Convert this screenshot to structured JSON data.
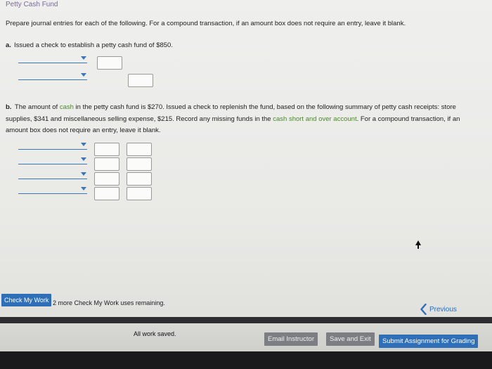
{
  "header": {
    "title": "Petty Cash Fund"
  },
  "instructions": "Prepare journal entries for each of the following. For a compound transaction, if an amount box does not require an entry, leave it blank.",
  "part_a": {
    "letter": "a.",
    "text": "Issued a check to establish a petty cash fund of $850."
  },
  "part_b": {
    "letter": "b.",
    "text_1": "The amount of ",
    "cash_link": "cash",
    "text_2": " in the petty cash fund is $270. Issued a check to replenish the fund, based on the following summary of petty cash receipts: store supplies, $341 and miscellaneous selling expense, $215. Record any missing funds in the ",
    "cash_short_link": "cash short and over account",
    "text_3": ". For a compound transaction, if an amount box does not require an entry, leave it blank."
  },
  "footer": {
    "check_my_work": "Check My Work",
    "remaining": "2 more Check My Work uses remaining.",
    "previous": "Previous",
    "saved_status": "All work saved.",
    "email_instructor": "Email Instructor",
    "save_exit": "Save and Exit",
    "submit": "Submit Assignment for Grading"
  },
  "colors": {
    "accent_blue": "#2e6fb7",
    "link_green": "#4a8a2a",
    "title_purple": "#7a6a9a"
  }
}
